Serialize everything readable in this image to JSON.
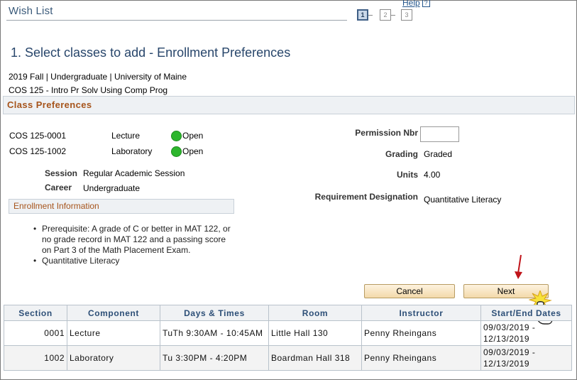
{
  "header": {
    "title": "Wish List",
    "help_label": "Help",
    "help_icon": "?",
    "steps": [
      "1",
      "2",
      "3"
    ],
    "active_step": 1
  },
  "page": {
    "heading": "1.  Select classes to add - Enrollment Preferences",
    "term": "2019 Fall | Undergraduate | University of Maine",
    "course": "COS  125 - Intro Pr Solv Using Comp Prog"
  },
  "class_preferences": {
    "title": "Class Preferences",
    "classes": [
      {
        "section": "COS  125-0001",
        "component": "Lecture",
        "status": "Open",
        "status_icon": "open-status-icon"
      },
      {
        "section": "COS  125-1002",
        "component": "Laboratory",
        "status": "Open",
        "status_icon": "open-status-icon"
      }
    ],
    "session_label": "Session",
    "session_value": "Regular Academic Session",
    "career_label": "Career",
    "career_value": "Undergraduate",
    "permission_label": "Permission Nbr",
    "permission_value": "",
    "grading_label": "Grading",
    "grading_value": "Graded",
    "units_label": "Units",
    "units_value": "4.00",
    "requirement_label": "Requirement Designation",
    "requirement_value": "Quantitative Literacy"
  },
  "enrollment_info": {
    "title": "Enrollment Information",
    "items": [
      "Prerequisite: A grade of C or better in MAT 122, or no grade record in MAT 122 and a passing score on Part 3 of the Math Placement Exam.",
      "Quantitative Literacy"
    ]
  },
  "buttons": {
    "cancel": "Cancel",
    "next": "Next"
  },
  "sections_table": {
    "headers": [
      "Section",
      "Component",
      "Days & Times",
      "Room",
      "Instructor",
      "Start/End Dates"
    ],
    "rows": [
      [
        "0001",
        "Lecture",
        "TuTh 9:30AM - 10:45AM",
        "Little Hall 130",
        "Penny Rheingans",
        "09/03/2019 - 12/13/2019"
      ],
      [
        "1002",
        "Laboratory",
        "Tu 3:30PM - 4:20PM",
        "Boardman Hall 318",
        "Penny Rheingans",
        "09/03/2019 - 12/13/2019"
      ]
    ]
  },
  "colors": {
    "accent": "#a6541b",
    "heading": "#28466b",
    "open_status": "#2db62d"
  }
}
